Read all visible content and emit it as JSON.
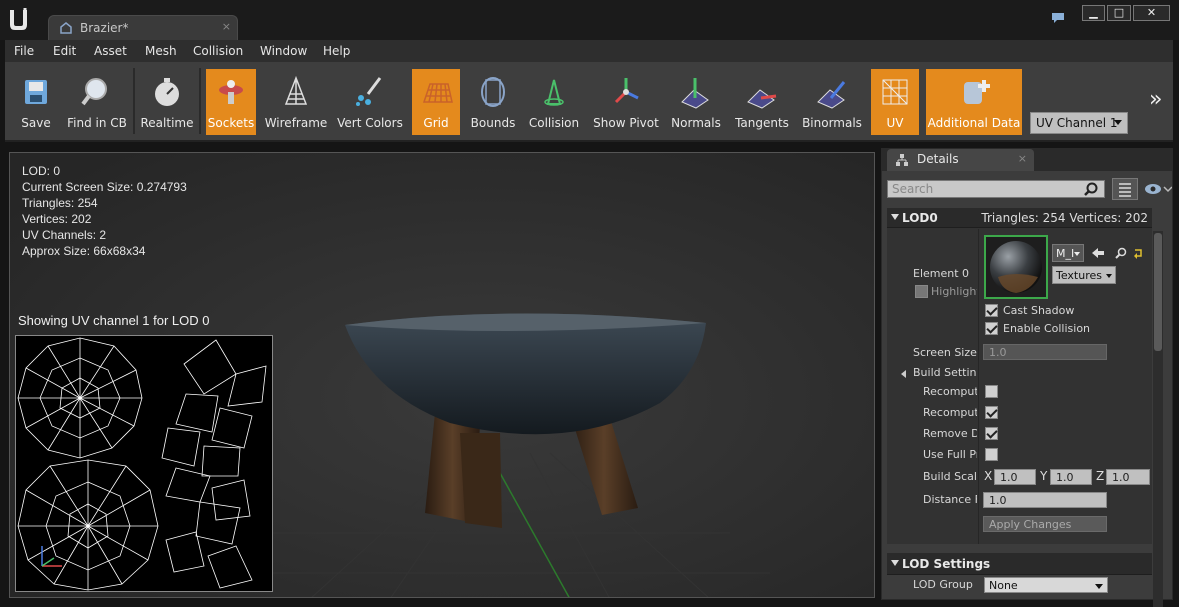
{
  "window": {
    "tab_title": "Brazier*",
    "tab_close": "×",
    "minimize": "▁",
    "maximize": "□",
    "close": "✕"
  },
  "menu": [
    "File",
    "Edit",
    "Asset",
    "Mesh",
    "Collision",
    "Window",
    "Help"
  ],
  "toolbar": {
    "buttons": [
      {
        "label": "Save",
        "icon": "save-icon",
        "active": false
      },
      {
        "label": "Find in CB",
        "icon": "find-in-cb-icon",
        "active": false
      },
      {
        "label": "Realtime",
        "icon": "stopwatch-icon",
        "active": false
      },
      {
        "label": "Sockets",
        "icon": "sockets-icon",
        "active": true
      },
      {
        "label": "Wireframe",
        "icon": "wireframe-icon",
        "active": false
      },
      {
        "label": "Vert Colors",
        "icon": "vert-colors-icon",
        "active": false
      },
      {
        "label": "Grid",
        "icon": "grid-icon",
        "active": true
      },
      {
        "label": "Bounds",
        "icon": "bounds-icon",
        "active": false
      },
      {
        "label": "Collision",
        "icon": "collision-icon",
        "active": false
      },
      {
        "label": "Show Pivot",
        "icon": "pivot-icon",
        "active": false
      },
      {
        "label": "Normals",
        "icon": "normals-icon",
        "active": false
      },
      {
        "label": "Tangents",
        "icon": "tangents-icon",
        "active": false
      },
      {
        "label": "Binormals",
        "icon": "binormals-icon",
        "active": false
      },
      {
        "label": "UV",
        "icon": "uv-icon",
        "active": true
      },
      {
        "label": "Additional Data",
        "icon": "additional-data-icon",
        "active": true
      }
    ],
    "uv_channel_dropdown": "UV Channel 1",
    "more": "»",
    "active_color": "#e48a1d"
  },
  "viewport": {
    "stats": [
      "LOD:  0",
      "Current Screen Size:  0.274793",
      "Triangles:  254",
      "Vertices:  202",
      "UV Channels:  2",
      "Approx Size: 66x68x34"
    ],
    "uv_caption": "Showing UV channel 1 for LOD 0"
  },
  "details": {
    "tab_title": "Details",
    "tab_close": "×",
    "search_placeholder": "Search",
    "lod0": {
      "title": "LOD0",
      "info": "Triangles: 254  Vertices: 202",
      "element_label": "Element 0",
      "highlight_label": "Highlight",
      "material_name": "M_I",
      "textures_label": "Textures",
      "cast_shadow": "Cast Shadow",
      "enable_collision": "Enable Collision",
      "screen_size_label": "Screen Size",
      "screen_size_value": "1.0",
      "build_settings_label": "Build Settings",
      "build_rows": [
        {
          "label": "Recompute Normals",
          "checked": false
        },
        {
          "label": "Recompute Tangents",
          "checked": true
        },
        {
          "label": "Remove Degenerates",
          "checked": true
        },
        {
          "label": "Use Full Precision UVs",
          "checked": false
        }
      ],
      "build_scale_label": "Build Scale",
      "build_scale": {
        "x_label": "X",
        "x": "1.0",
        "y_label": "Y",
        "y": "1.0",
        "z_label": "Z",
        "z": "1.0"
      },
      "distance_label": "Distance Field Resolution Scale",
      "distance_value": "1.0",
      "apply_changes": "Apply Changes"
    },
    "lod_settings": {
      "title": "LOD Settings",
      "lod_group_label": "LOD Group",
      "lod_group_value": "None"
    }
  }
}
